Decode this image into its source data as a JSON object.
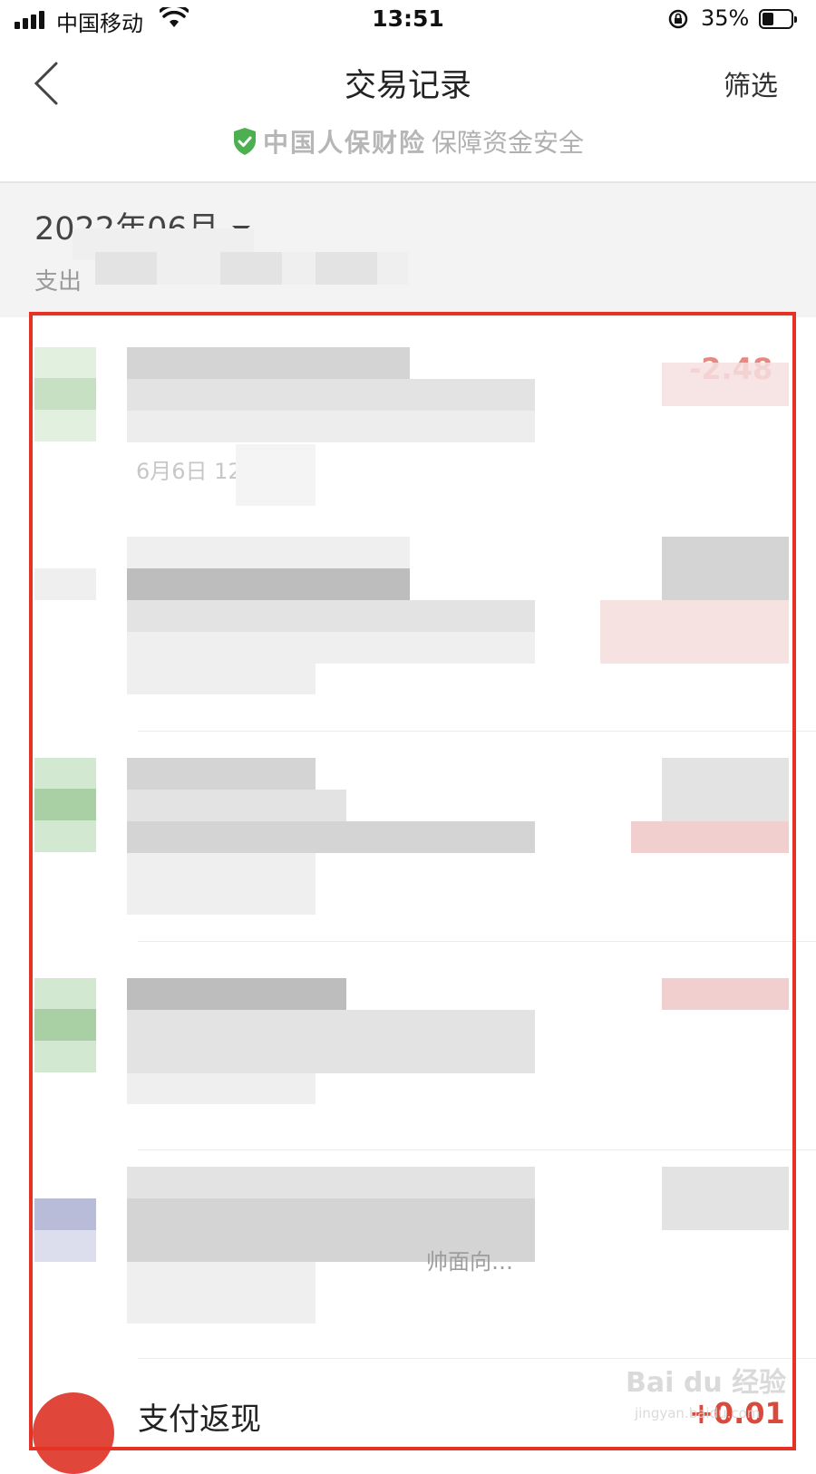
{
  "status_bar": {
    "carrier": "中国移动",
    "time": "13:51",
    "battery": "35%",
    "icons": [
      "signal-icon",
      "wifi-icon",
      "rotation-lock-icon",
      "battery-icon"
    ]
  },
  "nav": {
    "title": "交易记录",
    "filter_label": "筛选",
    "back_icon": "chevron-left-icon"
  },
  "security": {
    "brand": "中国人保财险",
    "text": "保障资金安全",
    "icon": "shield-check-icon",
    "icon_color": "#4caf50"
  },
  "month": {
    "label": "2022年06月",
    "summary_prefix": "支出"
  },
  "transactions": [
    {
      "date_partial": "6月6日 12:",
      "amount_partial": "-2.48"
    },
    {
      "sub_partial": "帅面向…"
    },
    {
      "title": "支付返现",
      "amount": "+0.01"
    }
  ],
  "colors": {
    "amount_red": "#d94a3d",
    "highlight": "#e53225",
    "header_bg": "#f3f3f3"
  },
  "watermark": {
    "text": "Bai du 经验",
    "sub": "jingyan.baidu.com"
  }
}
